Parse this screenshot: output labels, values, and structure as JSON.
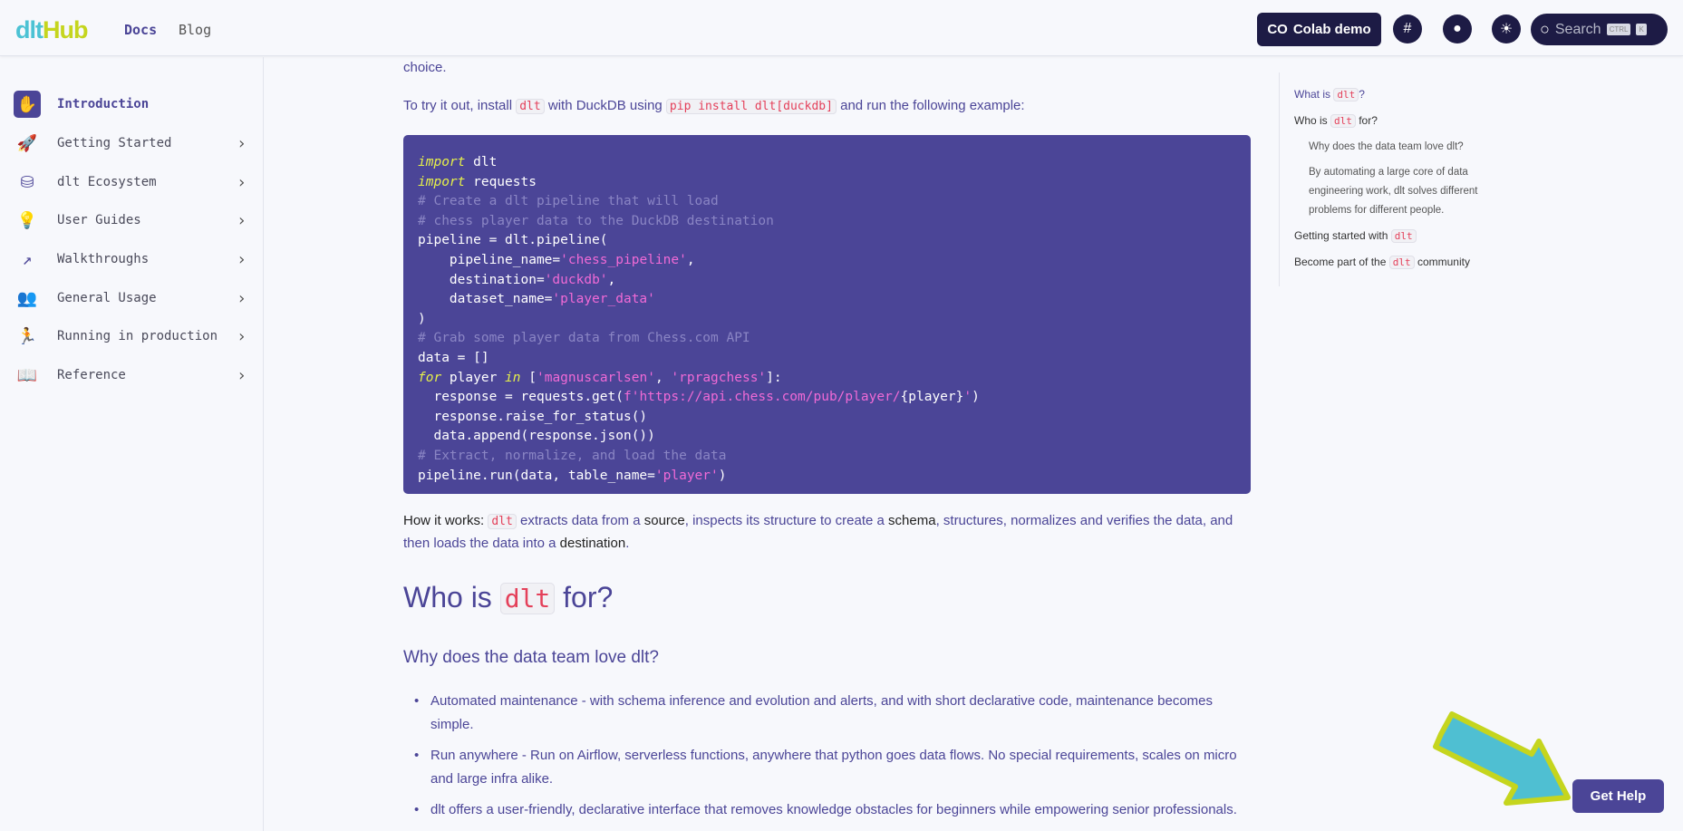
{
  "header": {
    "logo_a": "dlt",
    "logo_b": "Hub",
    "nav": [
      "Docs",
      "Blog"
    ],
    "colab_label": "Colab demo",
    "search_placeholder": "Search",
    "kbd": [
      "CTRL",
      "K"
    ]
  },
  "sidebar": {
    "items": [
      {
        "label": "Introduction",
        "icon": "✋"
      },
      {
        "label": "Getting Started",
        "icon": "🚀"
      },
      {
        "label": "dlt Ecosystem",
        "icon": "⛁"
      },
      {
        "label": "User Guides",
        "icon": "💡"
      },
      {
        "label": "Walkthroughs",
        "icon": "↗"
      },
      {
        "label": "General Usage",
        "icon": "👥"
      },
      {
        "label": "Running in production",
        "icon": "🏃"
      },
      {
        "label": "Reference",
        "icon": "📖"
      }
    ]
  },
  "content": {
    "choice": "choice.",
    "try_a": "To try it out, install ",
    "try_code1": "dlt",
    "try_b": " with DuckDB using ",
    "try_code2": "pip install dlt[duckdb]",
    "try_c": " and run the following example:",
    "how_a": "How it works: ",
    "how_code": "dlt",
    "how_b": " extracts data from a ",
    "how_source": "source",
    "how_c": ", inspects its structure to create a ",
    "how_schema": "schema",
    "how_d": ", structures, normalizes and verifies the data, and then loads the data into a ",
    "how_dest": "destination",
    "how_e": ".",
    "h2_a": "Who is ",
    "h2_code": "dlt",
    "h2_b": " for?",
    "h3": "Why does the data team love dlt?",
    "bullets": [
      "Automated maintenance - with schema inference and evolution and alerts, and with short declarative code, maintenance becomes simple.",
      "Run anywhere - Run on Airflow, serverless functions, anywhere that python goes data flows. No special requirements, scales on micro and large infra alike.",
      "dlt offers a user-friendly, declarative interface that removes knowledge obstacles for beginners while empowering senior professionals."
    ]
  },
  "toc": {
    "what_a": "What is ",
    "what_code": "dlt",
    "what_b": "?",
    "who_a": "Who is ",
    "who_code": "dlt",
    "who_b": " for?",
    "why": "Why does the data team love dlt?",
    "by": "By automating a large core of data engineering work, dlt solves different problems for different people.",
    "gs_a": "Getting started with ",
    "gs_code": "dlt",
    "bp_a": "Become part of the ",
    "bp_code": "dlt",
    "bp_b": " community"
  },
  "get_help": "Get Help",
  "colors": {
    "accent": "#4b4597",
    "code_red": "#e4405a",
    "header_dark": "#1d1b45"
  }
}
